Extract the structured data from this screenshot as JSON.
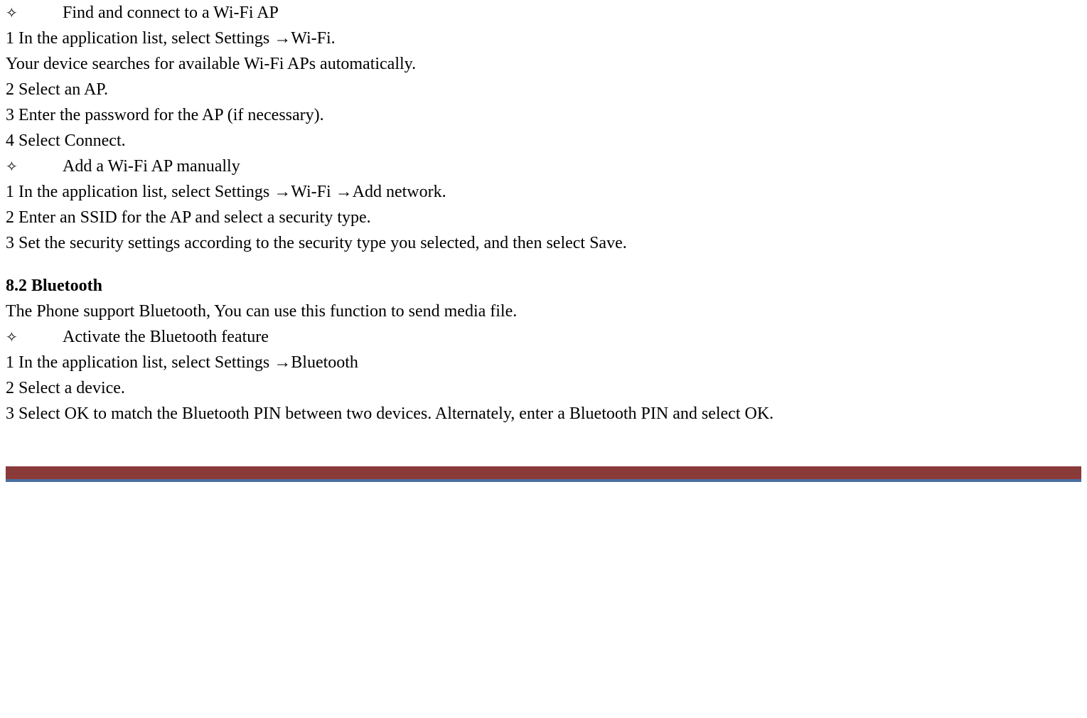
{
  "section1": {
    "bullet1": "Find and connect to a Wi-Fi AP",
    "line1a": "1 In the application list, select Settings ",
    "line1b": "Wi-Fi.",
    "line2": "Your device searches for available Wi-Fi APs automatically.",
    "line3": "2 Select an AP.",
    "line4": "3 Enter the password for the AP (if necessary).",
    "line5": "4 Select Connect.",
    "bullet2": "Add a Wi-Fi AP manually",
    "line6a": "1 In the application list, select Settings ",
    "line6b": "Wi-Fi ",
    "line6c": "Add network.",
    "line7": "2 Enter an SSID for the AP and select a security type.",
    "line8": "3 Set the security settings according to the security type you selected, and then select Save."
  },
  "section2": {
    "heading": "8.2 Bluetooth",
    "intro": "The Phone support Bluetooth, You can use this function to send media file.",
    "bullet1": "Activate the Bluetooth feature",
    "line1a": "1 In the application list, select Settings ",
    "line1b": "Bluetooth",
    "line2": "2 Select a device.",
    "line3": "3 Select OK to match the Bluetooth PIN between two devices. Alternately, enter a Bluetooth PIN and select OK."
  },
  "symbols": {
    "diamond": "✧",
    "arrow": "→"
  }
}
